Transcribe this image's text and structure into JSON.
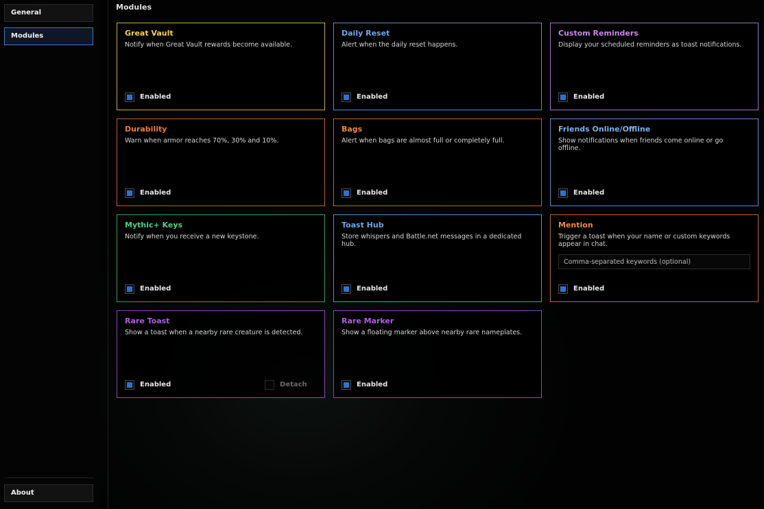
{
  "sidebar": {
    "items": [
      {
        "label": "General",
        "active": false
      },
      {
        "label": "Modules",
        "active": true
      }
    ],
    "footer": {
      "label": "About"
    }
  },
  "page": {
    "title": "Modules"
  },
  "colors": {
    "accent": "#3d7ac4",
    "checkbox_fill": "#2a73d6",
    "great_vault": "#f5d34a",
    "daily_reset": "#6ea6e8",
    "custom_reminders": "#c987e8",
    "durability": "#ef7b35",
    "bags": "#ef8a3c",
    "friends": "#7ab2ee",
    "mythic_keys": "#4fcf8a",
    "toast_hub": "#6ea6e8",
    "mention": "#ef8a3c",
    "rare_toast": "#b05ee0",
    "rare_marker": "#b05ee0"
  },
  "modules": [
    {
      "title": "Great Vault",
      "description": "Notify when Great Vault rewards become available.",
      "enabled_label": "Enabled",
      "enabled": true
    },
    {
      "title": "Daily Reset",
      "description": "Alert when the daily reset happens.",
      "enabled_label": "Enabled",
      "enabled": true
    },
    {
      "title": "Custom Reminders",
      "description": "Display your scheduled reminders as toast notifications.",
      "enabled_label": "Enabled",
      "enabled": true
    },
    {
      "title": "Durability",
      "description": "Warn when armor reaches 70%, 30% and 10%.",
      "enabled_label": "Enabled",
      "enabled": true
    },
    {
      "title": "Bags",
      "description": "Alert when bags are almost full or completely full.",
      "enabled_label": "Enabled",
      "enabled": true
    },
    {
      "title": "Friends Online/Offline",
      "description": "Show notifications when friends come online or go offline.",
      "enabled_label": "Enabled",
      "enabled": true
    },
    {
      "title": "Mythic+ Keys",
      "description": "Notify when you receive a new keystone.",
      "enabled_label": "Enabled",
      "enabled": true
    },
    {
      "title": "Toast Hub",
      "description": "Store whispers and Battle.net messages in a dedicated hub.",
      "enabled_label": "Enabled",
      "enabled": true
    },
    {
      "title": "Mention",
      "description": "Trigger a toast when your name or custom keywords appear in chat.",
      "enabled_label": "Enabled",
      "enabled": true,
      "keywords_placeholder": "Comma-separated keywords (optional)",
      "keywords_value": ""
    },
    {
      "title": "Rare Toast",
      "description": "Show a toast when a nearby rare creature is detected.",
      "enabled_label": "Enabled",
      "enabled": true,
      "detach_label": "Detach",
      "detach": false
    },
    {
      "title": "Rare Marker",
      "description": "Show a floating marker above nearby rare nameplates.",
      "enabled_label": "Enabled",
      "enabled": true
    }
  ]
}
